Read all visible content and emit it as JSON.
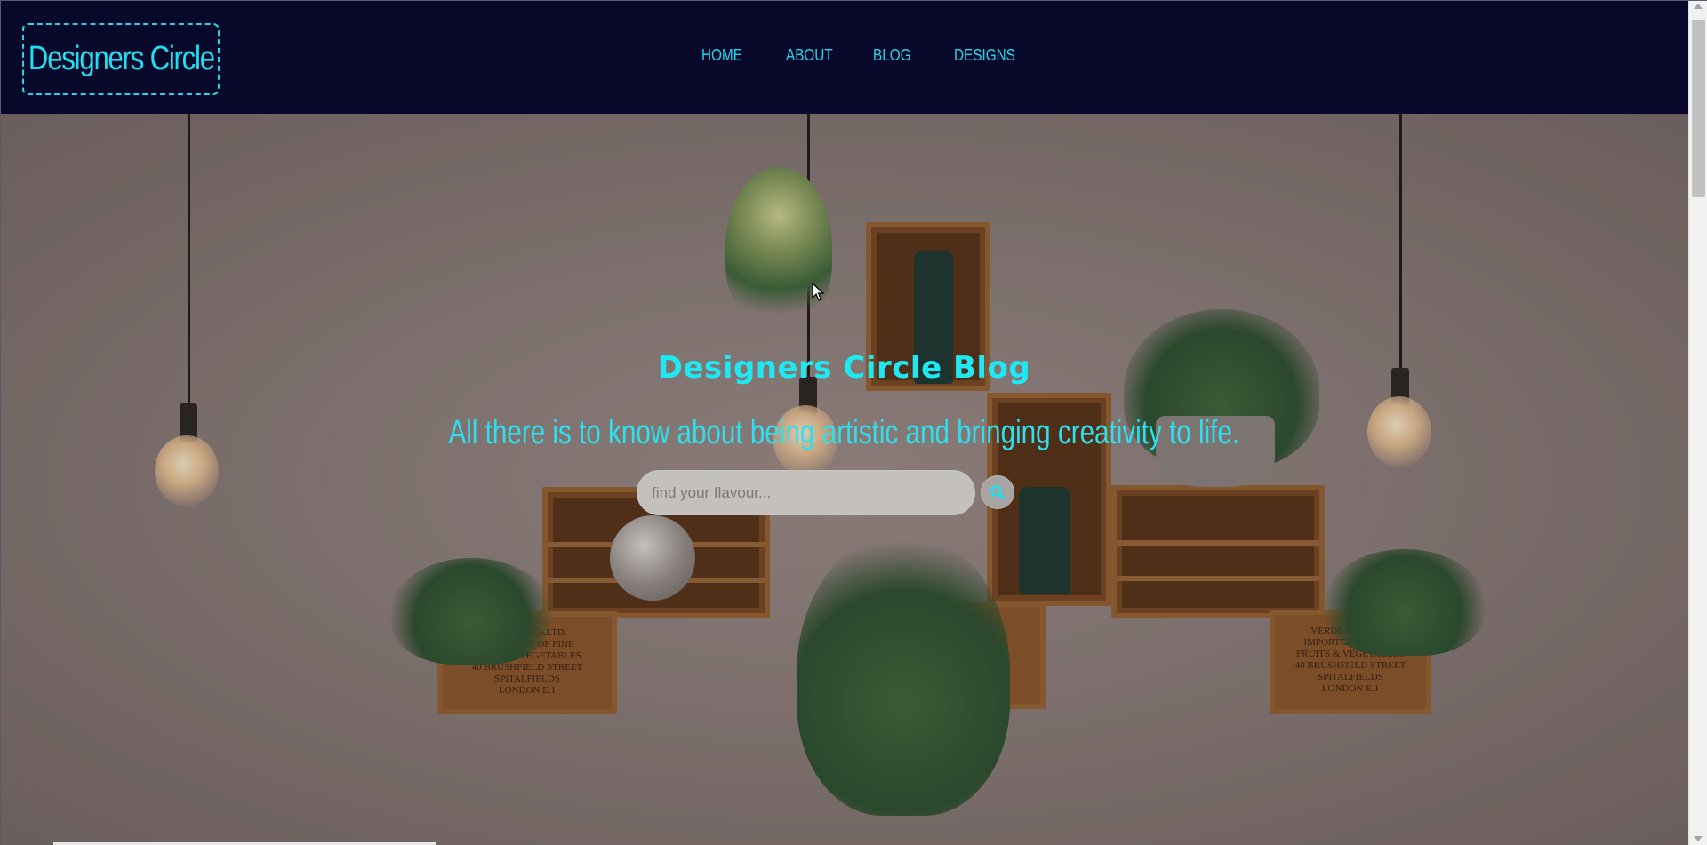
{
  "window": {
    "title": "Designers Circle"
  },
  "navbar": {
    "logo_text": "Designers Circle",
    "links": [
      {
        "label": "HOME"
      },
      {
        "label": "ABOUT"
      },
      {
        "label": "BLOG"
      },
      {
        "label": "DESIGNS"
      }
    ]
  },
  "hero": {
    "title": "Designers Circle Blog",
    "subtitle": "All there is to know about being artistic and bringing creativity to life.",
    "search": {
      "placeholder": "find your flavour...",
      "value": "",
      "button_icon": "search-icon"
    },
    "crate_labels": [
      "VERDE & Co.LTD.\nIMPORTERS OF FINE\nFRUITS & VEGETABLES\n40 BRUSHFIELD STREET\nSPITALFIELDS\nLONDON E.1",
      "VERDE & Co.LTD.\nIMPORTERS OF FINE\nFRUITS & VEGETABLES\n40 BRUSHFIELD STREET\nSPITALFIELDS\nLONDON E.1"
    ]
  },
  "colors": {
    "navbar_bg": "#08082a",
    "accent": "#1fe0f0",
    "search_bg": "#c4c0bd"
  }
}
